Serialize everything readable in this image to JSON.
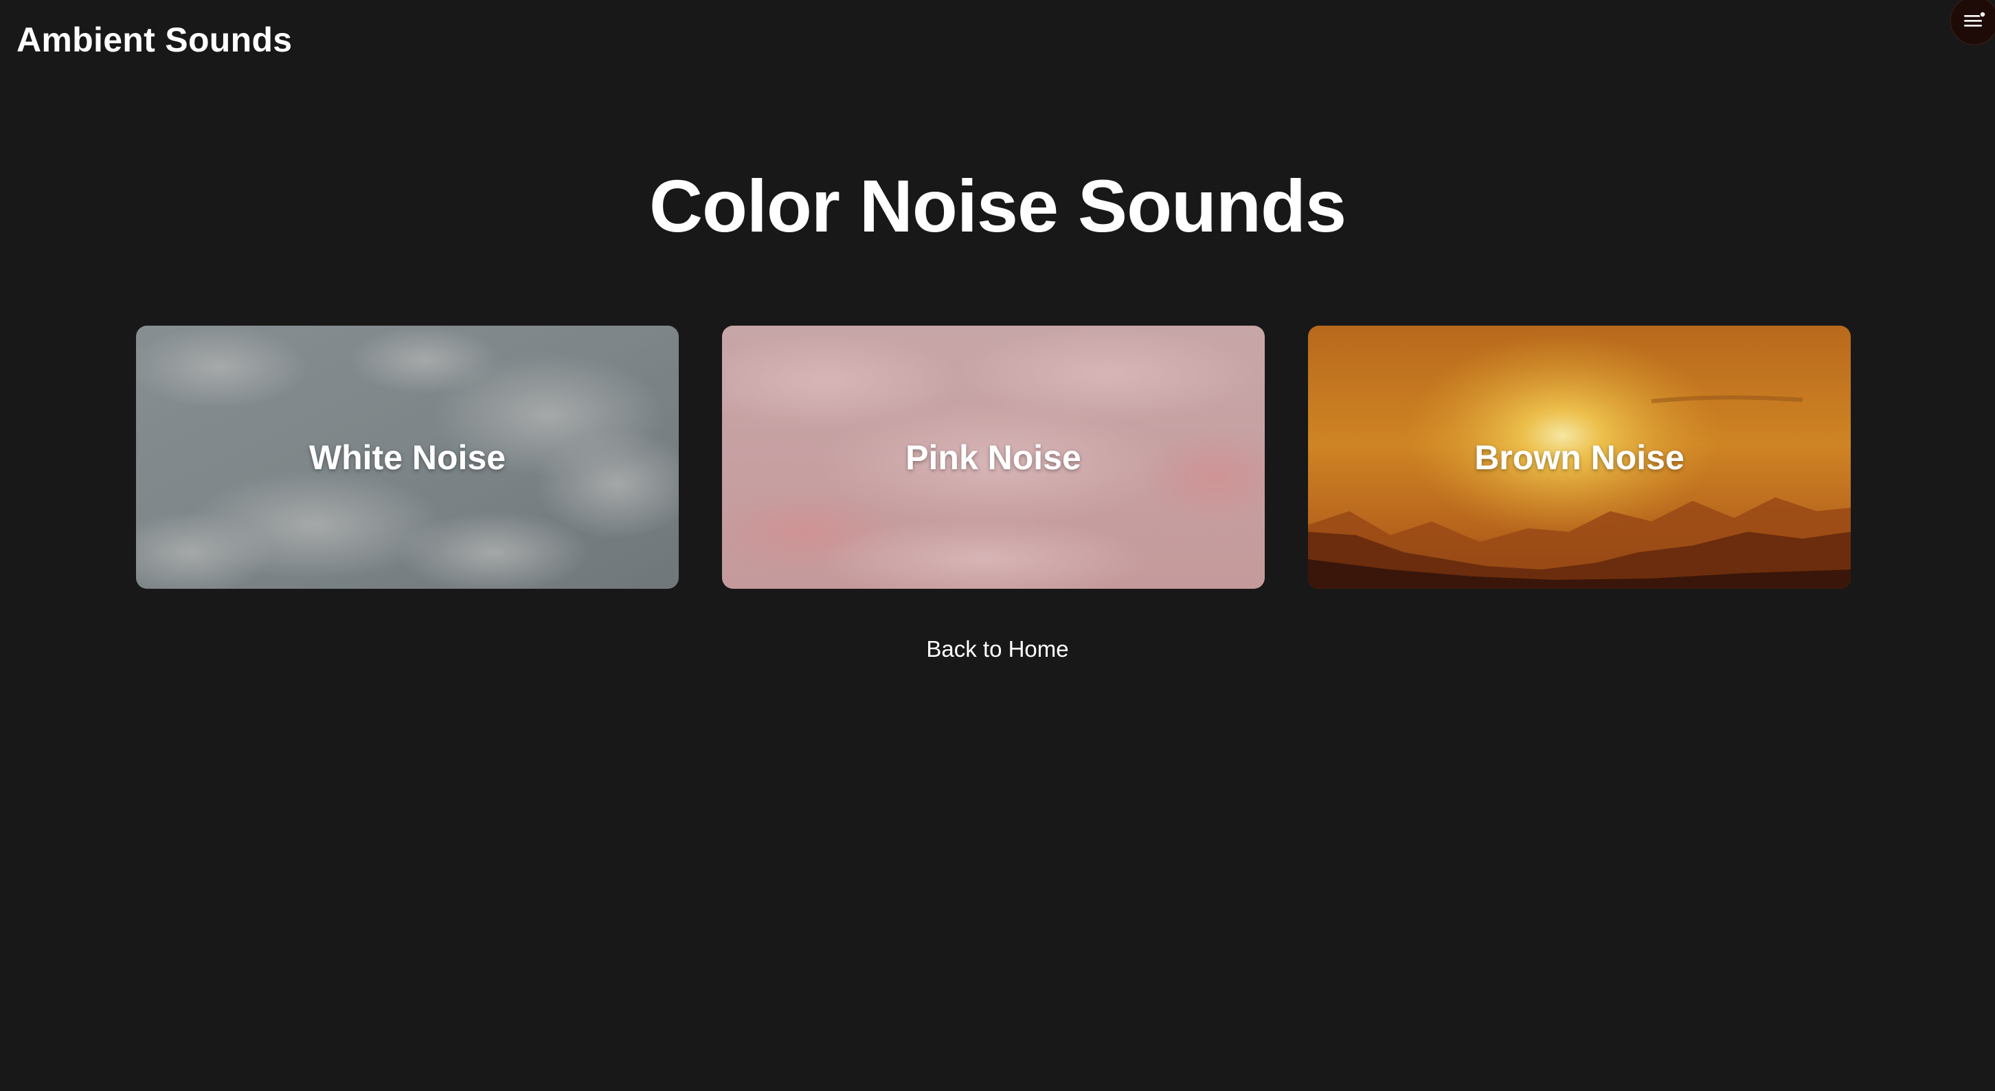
{
  "header": {
    "app_title": "Ambient Sounds",
    "menu_icon": "hamburger-menu-icon"
  },
  "main": {
    "heading": "Color Noise Sounds",
    "cards": [
      {
        "label": "White Noise",
        "theme": "cloudy-sky",
        "tint": "#8e979c"
      },
      {
        "label": "Pink Noise",
        "theme": "pink-clouds",
        "tint": "#c9a2a3"
      },
      {
        "label": "Brown Noise",
        "theme": "sunset-mountains",
        "tint": "#c9771f"
      }
    ],
    "back_link": "Back to Home"
  },
  "colors": {
    "background": "#181818",
    "text": "#ffffff",
    "menu_button": "#1e0b08"
  }
}
